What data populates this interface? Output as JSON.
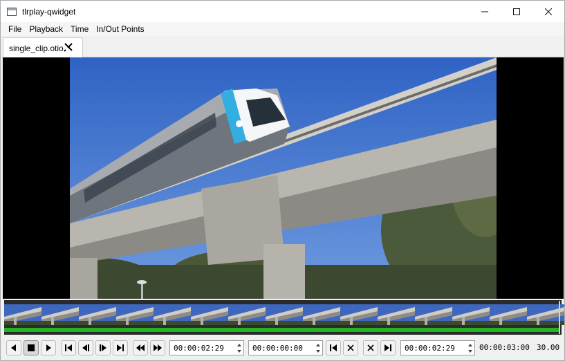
{
  "window": {
    "title": "tlrplay-qwidget"
  },
  "menu": [
    "File",
    "Playback",
    "Time",
    "In/Out Points"
  ],
  "tabs": [
    {
      "label": "single_clip.otio"
    }
  ],
  "controls": {
    "current_time": "00:00:02:29",
    "in_point": "00:00:00:00",
    "out_point": "00:00:02:29",
    "duration": "00:00:03:00",
    "fps": "30.00"
  },
  "timeline": {
    "progress": 1.0
  },
  "icons": {
    "minimize": "minimize-icon",
    "maximize": "maximize-icon",
    "close": "close-icon",
    "tab_close": "tab-close-icon"
  },
  "colors": {
    "progress": "#21b521",
    "sky": "#3a6fd0"
  }
}
